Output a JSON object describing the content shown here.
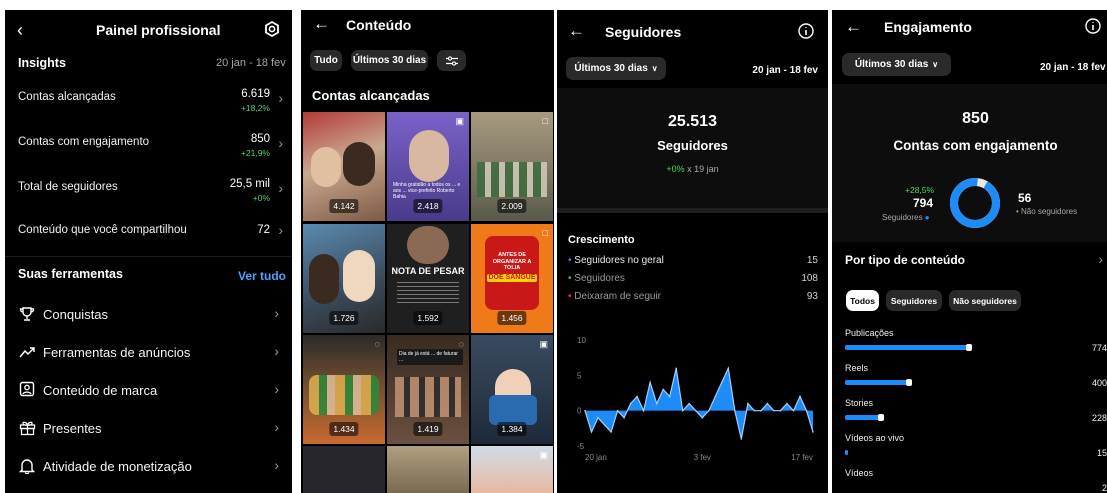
{
  "p1": {
    "title": "Painel profissional",
    "insights_title": "Insights",
    "date_range": "20 jan - 18 fev",
    "metrics": [
      {
        "label": "Contas alcançadas",
        "value": "6.619",
        "delta": "+18,2%"
      },
      {
        "label": "Contas com engajamento",
        "value": "850",
        "delta": "+21,9%"
      },
      {
        "label": "Total de seguidores",
        "value": "25,5 mil",
        "delta": "+0%"
      },
      {
        "label": "Conteúdo que você compartilhou",
        "value": "72",
        "delta": ""
      }
    ],
    "tools_title": "Suas ferramentas",
    "see_all": "Ver tudo",
    "tools": [
      {
        "label": "Conquistas",
        "icon": "trophy-icon"
      },
      {
        "label": "Ferramentas de anúncios",
        "icon": "trend-icon"
      },
      {
        "label": "Conteúdo de marca",
        "icon": "brand-content-icon"
      },
      {
        "label": "Presentes",
        "icon": "gift-icon"
      },
      {
        "label": "Atividade de monetização",
        "icon": "bell-icon"
      }
    ]
  },
  "p2": {
    "title": "Conteúdo",
    "filters": [
      "Tudo",
      "Últimos 30 dias"
    ],
    "section_title": "Contas alcançadas",
    "tiles": [
      {
        "count": "4.142",
        "bg": "#8a6a55"
      },
      {
        "count": "2.418",
        "bg": "#6a5ab0",
        "caption": "Minha gratidão a todos os ... e aos ... vice-prefeito Roberto Bahia"
      },
      {
        "count": "2.009",
        "bg": "#6f6a5a"
      },
      {
        "count": "1.726",
        "bg": "#3d6a8a"
      },
      {
        "count": "1.592",
        "bg": "#2a2a2a",
        "heading": "NOTA DE PESAR"
      },
      {
        "count": "1.456",
        "bg": "#f07a1a",
        "heading1": "ANTES DE ORGANIZAR A TOLIA",
        "heading2": "DOE SANGUE"
      },
      {
        "count": "1.434",
        "bg": "#5a4030"
      },
      {
        "count": "1.419",
        "bg": "#4a3a2a",
        "caption": "Dia de já está ... de faturar ..."
      },
      {
        "count": "1.384",
        "bg": "#2e3e55"
      },
      {
        "count": "",
        "bg": "#2a2a30"
      },
      {
        "count": "",
        "bg": "#9a8a70"
      },
      {
        "count": "",
        "bg": "#c9d7e2"
      }
    ]
  },
  "p3": {
    "title": "Seguidores",
    "period_label": "Últimos 30 dias",
    "date_range": "20 jan - 18 fev",
    "followers_value": "25.513",
    "followers_label": "Seguidores",
    "growth_pct": "+0%",
    "growth_since": "x 19 jan",
    "growth_title": "Crescimento",
    "growth_items": [
      {
        "label": "Seguidores no geral",
        "value": "15",
        "color": "#1d8cf8"
      },
      {
        "label": "Seguidores",
        "value": "108",
        "color": "#1ec8a0"
      },
      {
        "label": "Deixaram de seguir",
        "value": "93",
        "color": "#ff3040"
      }
    ],
    "chart_data": {
      "type": "area",
      "y_ticks": [
        "10",
        "5",
        "0",
        "-5"
      ],
      "x_ticks": [
        "20 jan",
        "3 fev",
        "17 fev"
      ],
      "ylim": [
        -5,
        10
      ],
      "values": [
        0,
        -3,
        -1,
        -2,
        -3,
        0,
        -1,
        1,
        2,
        0,
        4,
        1,
        3,
        2,
        6,
        0,
        1,
        0,
        -1,
        0,
        2,
        4,
        6,
        0,
        -4,
        1,
        0,
        0,
        1,
        0,
        0,
        1,
        0,
        2,
        0,
        -3
      ]
    },
    "accent": "#1d8cf8"
  },
  "p4": {
    "title": "Engajamento",
    "period_label": "Últimos 30 dias",
    "date_range": "20 jan - 18 fev",
    "value": "850",
    "value_label": "Contas com engajamento",
    "followers_delta": "+28,5%",
    "followers_value": "794",
    "followers_label": "Seguidores",
    "non_followers_value": "56",
    "non_followers_label": "Não seguidores",
    "by_type_title": "Por tipo de conteúdo",
    "tabs": [
      "Todos",
      "Seguidores",
      "Não seguidores"
    ],
    "types": [
      {
        "label": "Publicações",
        "value": "774",
        "fraction": 1.0
      },
      {
        "label": "Reels",
        "value": "400",
        "fraction": 0.52
      },
      {
        "label": "Stories",
        "value": "228",
        "fraction": 0.29
      },
      {
        "label": "Vídeos ao vivo",
        "value": "15",
        "fraction": 0.02
      },
      {
        "label": "Vídeos",
        "value": "2",
        "fraction": 0.0
      }
    ],
    "ring_followers_fraction": 0.934
  }
}
